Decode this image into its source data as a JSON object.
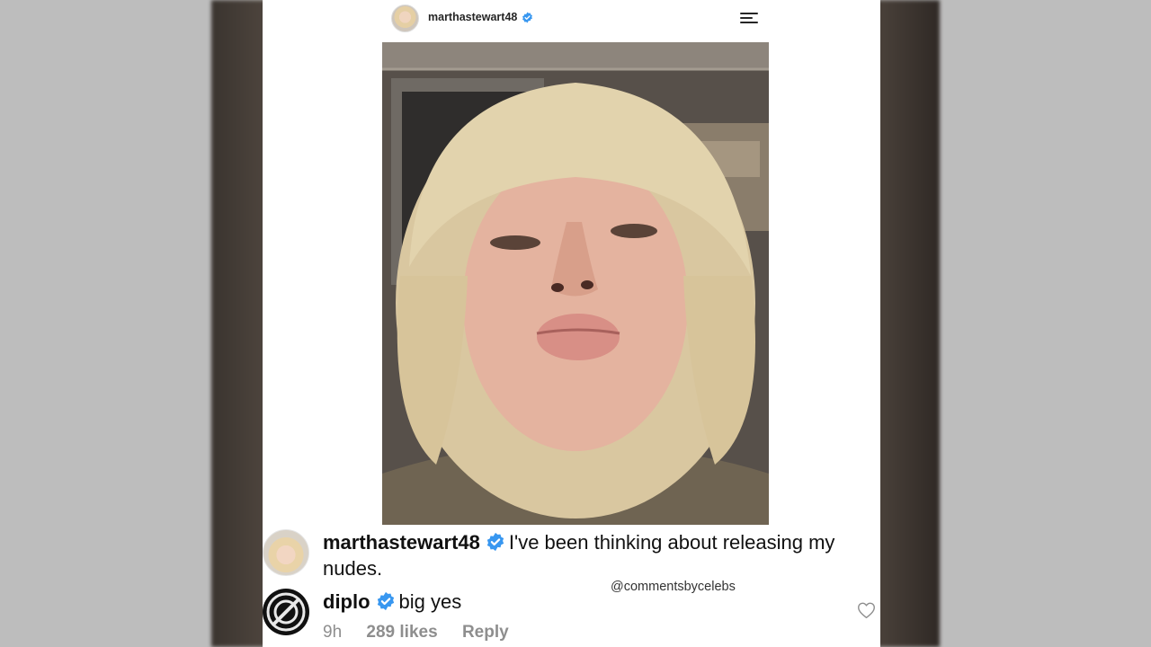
{
  "post": {
    "username": "marthastewart48",
    "verified": true
  },
  "caption": {
    "username": "marthastewart48",
    "text_line1": "I've been thinking about releasing my",
    "text_line2": "nudes."
  },
  "reply": {
    "username": "diplo",
    "text": "big yes",
    "age": "9h",
    "likes": "289 likes",
    "reply_label": "Reply"
  },
  "watermark": "@commentsbycelebs",
  "colors": {
    "verified_blue": "#3897f0",
    "text": "#111111",
    "meta_gray": "#8e8e8e"
  },
  "icons": [
    "verified-badge-icon",
    "menu-icon",
    "heart-icon"
  ]
}
